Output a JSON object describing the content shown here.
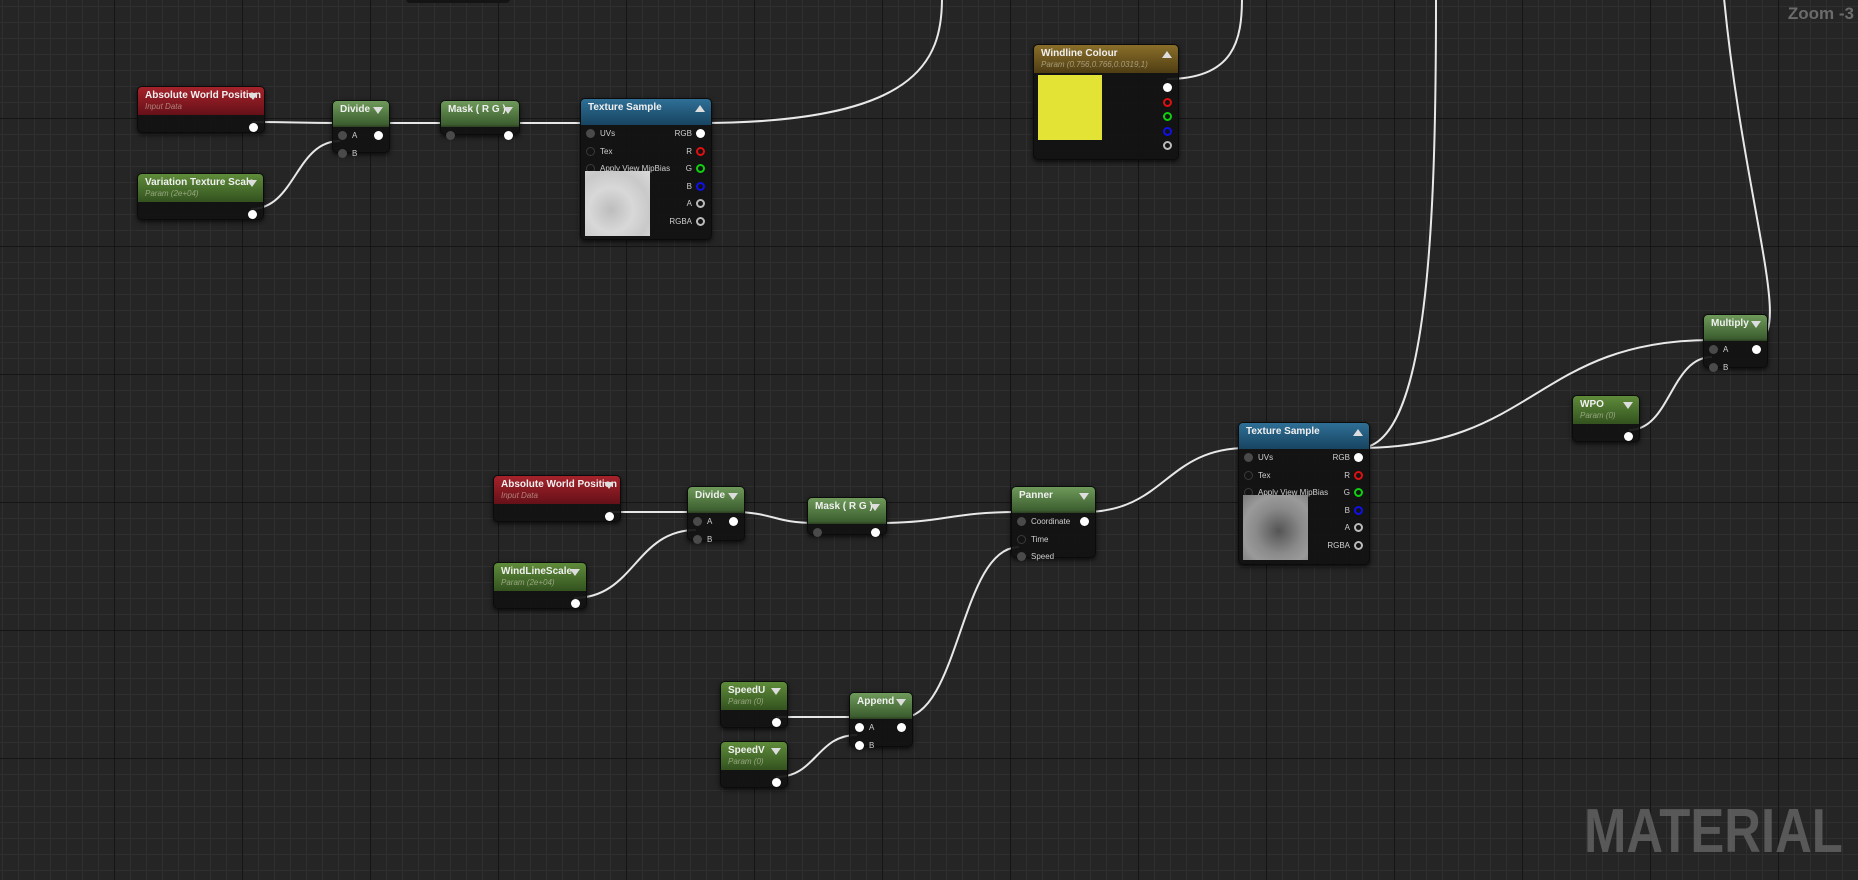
{
  "view": {
    "zoom_label": "Zoom -3",
    "watermark": "MATERIAL"
  },
  "colors": {
    "windline_swatch": "#e3e336",
    "pin_r": "#e01010",
    "pin_g": "#10d010",
    "pin_b": "#1010e8",
    "pin_a": "#bbbbbb"
  },
  "nodes": {
    "awp1": {
      "title": "Absolute World Position",
      "subtitle": "Input Data",
      "kind": "red",
      "inputs": [],
      "outputs": [
        ""
      ]
    },
    "vts": {
      "title": "Variation Texture Scale",
      "subtitle": "Param (2e+04)",
      "kind": "param",
      "inputs": [],
      "outputs": [
        ""
      ]
    },
    "div1": {
      "title": "Divide",
      "kind": "green",
      "inputs": [
        "A",
        "B"
      ],
      "outputs": [
        ""
      ]
    },
    "mask1": {
      "title": "Mask ( R G )",
      "kind": "green",
      "inputs": [
        ""
      ],
      "outputs": [
        ""
      ]
    },
    "ts1": {
      "title": "Texture Sample",
      "kind": "blue",
      "inputs": [
        "UVs",
        "Tex",
        "Apply View MipBias"
      ],
      "outputs": [
        "RGB",
        "R",
        "G",
        "B",
        "A",
        "RGBA"
      ],
      "preview": "light-noise"
    },
    "wind": {
      "title": "Windline Colour",
      "subtitle": "Param (0.756,0.766,0.0319,1)",
      "kind": "gold",
      "inputs": [],
      "outputs": [
        "",
        "",
        "",
        "",
        ""
      ]
    },
    "mult": {
      "title": "Multiply",
      "kind": "green",
      "inputs": [
        "A",
        "B"
      ],
      "outputs": [
        ""
      ]
    },
    "wpo": {
      "title": "WPO",
      "subtitle": "Param (0)",
      "kind": "param",
      "inputs": [],
      "outputs": [
        ""
      ]
    },
    "ts2": {
      "title": "Texture Sample",
      "kind": "blue",
      "inputs": [
        "UVs",
        "Tex",
        "Apply View MipBias"
      ],
      "outputs": [
        "RGB",
        "R",
        "G",
        "B",
        "A",
        "RGBA"
      ],
      "preview": "dark-noise"
    },
    "awp2": {
      "title": "Absolute World Position",
      "subtitle": "Input Data",
      "kind": "red",
      "inputs": [],
      "outputs": [
        ""
      ]
    },
    "div2": {
      "title": "Divide",
      "kind": "green",
      "inputs": [
        "A",
        "B"
      ],
      "outputs": [
        ""
      ]
    },
    "mask2": {
      "title": "Mask ( R G )",
      "kind": "green",
      "inputs": [
        ""
      ],
      "outputs": [
        ""
      ]
    },
    "panner": {
      "title": "Panner",
      "kind": "green",
      "inputs": [
        "Coordinate",
        "Time",
        "Speed"
      ],
      "outputs": [
        ""
      ]
    },
    "wls": {
      "title": "WindLineScale",
      "subtitle": "Param (2e+04)",
      "kind": "param",
      "inputs": [],
      "outputs": [
        ""
      ]
    },
    "speedu": {
      "title": "SpeedU",
      "subtitle": "Param (0)",
      "kind": "param",
      "inputs": [],
      "outputs": [
        ""
      ]
    },
    "speedv": {
      "title": "SpeedV",
      "subtitle": "Param (0)",
      "kind": "param",
      "inputs": [],
      "outputs": [
        ""
      ]
    },
    "append": {
      "title": "Append",
      "kind": "green",
      "inputs": [
        "A",
        "B"
      ],
      "outputs": [
        ""
      ]
    }
  }
}
